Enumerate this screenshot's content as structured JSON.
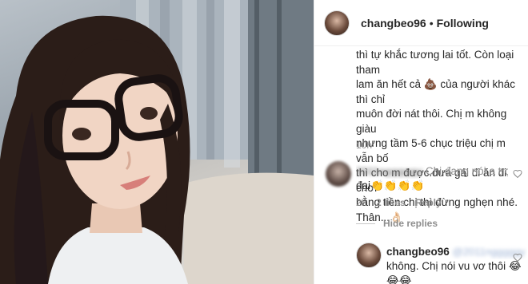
{
  "header": {
    "username": "changbeo96",
    "separator": "•",
    "follow_status": "Following"
  },
  "comment": {
    "lines": [
      "thì tự khắc tương lai tốt. Còn loại tham",
      "lam ăn hết cả 💩 của người khác thì chỉ",
      "muôn đời nát thôi. Chị m không giàu",
      "nhưng tầm 5-6 chục triệu chị m vẫn bố",
      "thì cho m được.đưa gái đi ăn đi chơi",
      "bằng tiền chị thì đừng nghẹn nhé.",
      "Thân...👌🏻"
    ],
    "time": "10h"
  },
  "reply1": {
    "username": "2011ngggggy",
    "text_line1": "Chị đang nói a trọng",
    "text_line2": "đại👏👏👏👏",
    "time": "2h",
    "likes": "2 likes",
    "reply_label": "Reply"
  },
  "hide_replies_label": "Hide replies",
  "reply2": {
    "username": "changbeo96",
    "mention": "@2011ngggggy",
    "text_line1": "không. Chị nói vu vơ thôi 😂",
    "text_line2": "😂😂"
  },
  "colors": {
    "text": "#262626",
    "secondary": "#8e8e8e",
    "border": "#efefef"
  }
}
